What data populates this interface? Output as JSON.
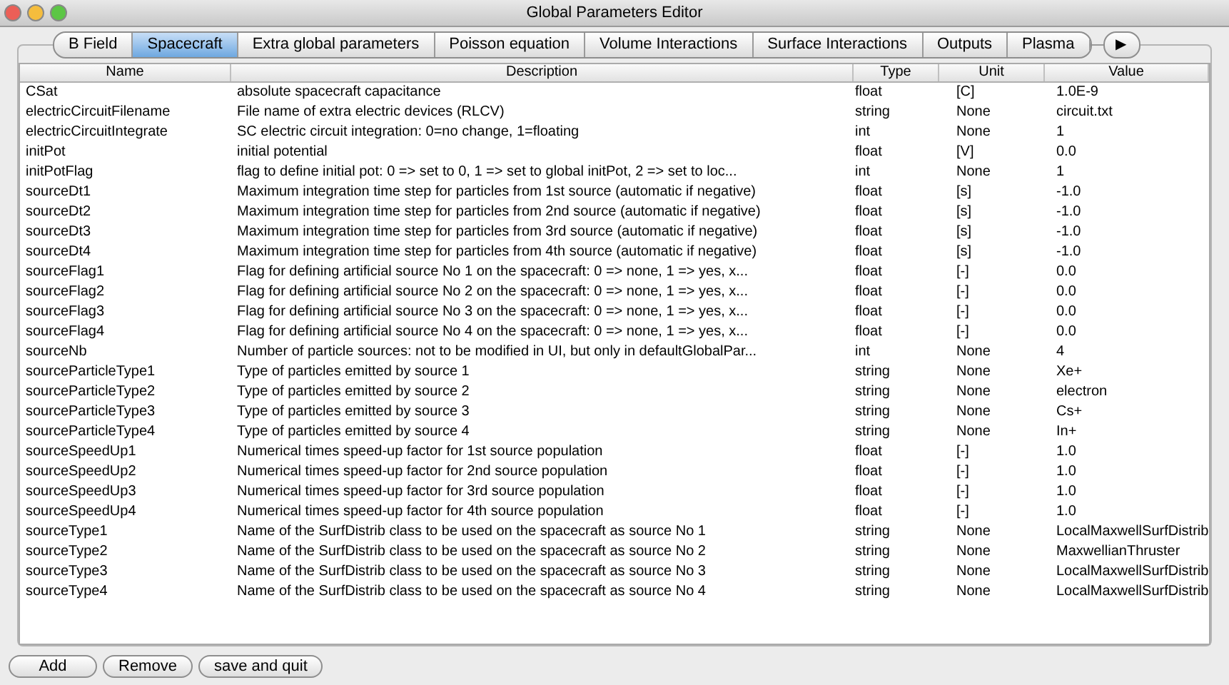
{
  "window": {
    "title": "Global Parameters Editor"
  },
  "tabs": [
    {
      "label": "B Field",
      "selected": false
    },
    {
      "label": "Spacecraft",
      "selected": true
    },
    {
      "label": "Extra global parameters",
      "selected": false
    },
    {
      "label": "Poisson equation",
      "selected": false
    },
    {
      "label": "Volume Interactions",
      "selected": false
    },
    {
      "label": "Surface Interactions",
      "selected": false
    },
    {
      "label": "Outputs",
      "selected": false
    },
    {
      "label": "Plasma",
      "selected": false
    }
  ],
  "tab_scroll": "▶",
  "table": {
    "columns": [
      "Name",
      "Description",
      "Type",
      "Unit",
      "Value"
    ],
    "rows": [
      [
        "CSat",
        "absolute spacecraft capacitance",
        "float",
        "[C]",
        "1.0E-9"
      ],
      [
        "electricCircuitFilename",
        "File name of extra electric devices (RLCV)",
        "string",
        "None",
        "circuit.txt"
      ],
      [
        "electricCircuitIntegrate",
        "SC electric circuit integration: 0=no change, 1=floating",
        "int",
        "None",
        "1"
      ],
      [
        "initPot",
        "initial potential",
        "float",
        "[V]",
        "0.0"
      ],
      [
        "initPotFlag",
        "flag to define initial pot: 0 => set to 0, 1 => set to global initPot, 2 => set to loc...",
        "int",
        "None",
        "1"
      ],
      [
        "sourceDt1",
        "Maximum integration time step for particles from 1st source (automatic if negative)",
        "float",
        "[s]",
        "-1.0"
      ],
      [
        "sourceDt2",
        "Maximum integration time step for particles from 2nd source (automatic if negative)",
        "float",
        "[s]",
        "-1.0"
      ],
      [
        "sourceDt3",
        "Maximum integration time step for particles from 3rd source (automatic if negative)",
        "float",
        "[s]",
        "-1.0"
      ],
      [
        "sourceDt4",
        "Maximum integration time step for particles from 4th source (automatic if negative)",
        "float",
        "[s]",
        "-1.0"
      ],
      [
        "sourceFlag1",
        "Flag for defining artificial source No 1 on the spacecraft: 0 => none, 1 => yes, x...",
        "float",
        "[-]",
        "0.0"
      ],
      [
        "sourceFlag2",
        "Flag for defining artificial source No 2 on the spacecraft: 0 => none, 1 => yes, x...",
        "float",
        "[-]",
        "0.0"
      ],
      [
        "sourceFlag3",
        "Flag for defining artificial source No 3 on the spacecraft: 0 => none, 1 => yes, x...",
        "float",
        "[-]",
        "0.0"
      ],
      [
        "sourceFlag4",
        "Flag for defining artificial source No 4 on the spacecraft: 0 => none, 1 => yes, x...",
        "float",
        "[-]",
        "0.0"
      ],
      [
        "sourceNb",
        "Number of particle sources: not to be modified in UI, but only in defaultGlobalPar...",
        "int",
        "None",
        "4"
      ],
      [
        "sourceParticleType1",
        "Type of particles emitted by source 1",
        "string",
        "None",
        "Xe+"
      ],
      [
        "sourceParticleType2",
        "Type of particles emitted by source 2",
        "string",
        "None",
        "electron"
      ],
      [
        "sourceParticleType3",
        "Type of particles emitted by source 3",
        "string",
        "None",
        "Cs+"
      ],
      [
        "sourceParticleType4",
        "Type of particles emitted by source 4",
        "string",
        "None",
        "In+"
      ],
      [
        "sourceSpeedUp1",
        "Numerical times speed-up factor for 1st source population",
        "float",
        "[-]",
        "1.0"
      ],
      [
        "sourceSpeedUp2",
        "Numerical times speed-up factor for 2nd source population",
        "float",
        "[-]",
        "1.0"
      ],
      [
        "sourceSpeedUp3",
        "Numerical times speed-up factor for 3rd source population",
        "float",
        "[-]",
        "1.0"
      ],
      [
        "sourceSpeedUp4",
        "Numerical times speed-up factor for 4th source population",
        "float",
        "[-]",
        "1.0"
      ],
      [
        "sourceType1",
        "Name of the SurfDistrib class to be used on the spacecraft as source No 1",
        "string",
        "None",
        "LocalMaxwellSurfDistrib"
      ],
      [
        "sourceType2",
        "Name of the SurfDistrib class to be used on the spacecraft as source No 2",
        "string",
        "None",
        "MaxwellianThruster"
      ],
      [
        "sourceType3",
        "Name of the SurfDistrib class to be used on the spacecraft as source No 3",
        "string",
        "None",
        "LocalMaxwellSurfDistrib"
      ],
      [
        "sourceType4",
        "Name of the SurfDistrib class to be used on the spacecraft as source No 4",
        "string",
        "None",
        "LocalMaxwellSurfDistrib"
      ]
    ]
  },
  "buttons": [
    "Add",
    "Remove",
    "save and quit"
  ]
}
